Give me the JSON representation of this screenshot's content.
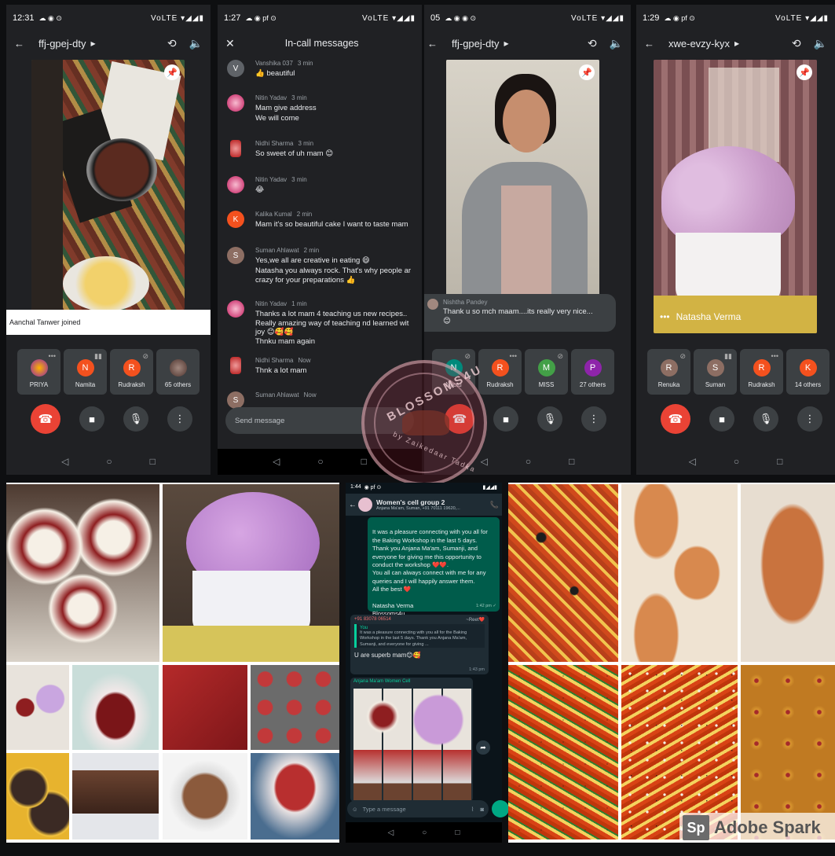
{
  "panel1": {
    "status_time": "12:31",
    "status_right": "VoLTE ▾◢◢▮",
    "meeting_code": "ffj-gpej-dty",
    "toast": "Aanchal Tanwer joined",
    "tiles": [
      {
        "initial": "",
        "name": "PRIYA",
        "color": "#8d6e63"
      },
      {
        "initial": "N",
        "name": "Namita",
        "color": "#f4511e"
      },
      {
        "initial": "R",
        "name": "Rudraksh",
        "color": "#f4511e"
      },
      {
        "initial": "",
        "name": "65 others",
        "color": "#6d4c41"
      }
    ]
  },
  "panel2": {
    "status_time": "1:27",
    "title": "In-call messages",
    "messages": [
      {
        "name": "Vanshika 037",
        "time": "3 min",
        "text": "👍 beautiful",
        "initial": "V",
        "color": "#5f6368"
      },
      {
        "name": "Nitin Yadav",
        "time": "3 min",
        "text": "Mam give address\nWe will come",
        "initial": "",
        "color": "#c2185b"
      },
      {
        "name": "Nidhi Sharma",
        "time": "3 min",
        "text": "So sweet of uh mam 😊",
        "initial": "",
        "color": "#b71c1c"
      },
      {
        "name": "Nitin Yadav",
        "time": "3 min",
        "text": "😂",
        "initial": "",
        "color": "#c2185b"
      },
      {
        "name": "Kalika Kumal",
        "time": "2 min",
        "text": "Mam it's so beautiful cake I want to taste mam",
        "initial": "K",
        "color": "#f4511e"
      },
      {
        "name": "Suman Ahlawat",
        "time": "2 min",
        "text": "Yes,we all are creative in eating 😄\nNatasha you always rock. That's why people ar\ncrazy for your preparations 👍",
        "initial": "S",
        "color": "#8d6e63"
      },
      {
        "name": "Nitin Yadav",
        "time": "1 min",
        "text": "Thanks a lot mam 4 teaching us new recipes..\nReally amazing way of teaching nd learned wit\njoy 😊🥰🥰\nThnku mam again",
        "initial": "",
        "color": "#c2185b"
      },
      {
        "name": "Nidhi Sharma",
        "time": "Now",
        "text": "Thnk a lot mam",
        "initial": "",
        "color": "#b71c1c"
      },
      {
        "name": "Suman Ahlawat",
        "time": "Now",
        "text": "",
        "initial": "S",
        "color": "#8d6e63"
      }
    ],
    "input_placeholder": "Send message"
  },
  "panel3": {
    "status_time": "05",
    "meeting_code": "ffj-gpej-dty",
    "caption_name": "Nishtha Pandey",
    "caption_text": "Thank u so mch maam....its really very nice...\n😊",
    "tiles": [
      {
        "initial": "N",
        "name": "Nyctu",
        "color": "#00897b"
      },
      {
        "initial": "R",
        "name": "Rudraksh",
        "color": "#f4511e"
      },
      {
        "initial": "M",
        "name": "MISS",
        "color": "#43a047"
      },
      {
        "initial": "P",
        "name": "27 others",
        "color": "#8e24aa"
      }
    ]
  },
  "panel4": {
    "status_time": "1:29",
    "meeting_code": "xwe-evzy-kyx",
    "speaker_name": "Natasha Verma",
    "tiles": [
      {
        "initial": "R",
        "name": "Renuka",
        "color": "#8d6e63"
      },
      {
        "initial": "S",
        "name": "Suman",
        "color": "#8d6e63"
      },
      {
        "initial": "R",
        "name": "Rudraksh",
        "color": "#f4511e"
      },
      {
        "initial": "K",
        "name": "14 others",
        "color": "#f4511e"
      }
    ]
  },
  "whatsapp": {
    "status_time": "1:44",
    "group_name": "Women's cell group 2",
    "members": "Anjana Ma'am, Suman, +91 70111 19620,...",
    "message": "It was a pleasure connecting with you all for the Baking Workshop in the last 5 days. Thank you Anjana Ma'am, Sumanji, and everyone for giving me this opportunity to conduct the workshop ❤️❤️.\nYou all can always connect with me for any queries and I will happily answer them.\nAll the best ❤️\n\nNatasha Verma\nBlossoms4u",
    "message_time": "1:42 pm ✓",
    "reply_sender": "+91 83078 06514",
    "reply_tag": "~Reet❤️",
    "quote_author": "You",
    "quote_text": "It was a pleasure connecting with you all for the Baking Workshop in the last 5 days. Thank you Anjana Ma'am, Sumanji, and everyone for giving ...",
    "reply_text": "U are superb mam😊🥰",
    "reply_time": "1:43 pm",
    "forward_label": "Anjana Ma'am Women Cell",
    "input_placeholder": "Type a message"
  },
  "watermark": {
    "brand": "BLOSSOMS4U",
    "sub": "by Zaikedaar Tadka"
  },
  "adobe": {
    "logo": "Sp",
    "text": "Adobe Spark"
  },
  "colors": {
    "meet_bg": "#202124",
    "end_call": "#ea4335",
    "wa_bubble": "#005c4b",
    "tile_bg": "#3c4043"
  }
}
